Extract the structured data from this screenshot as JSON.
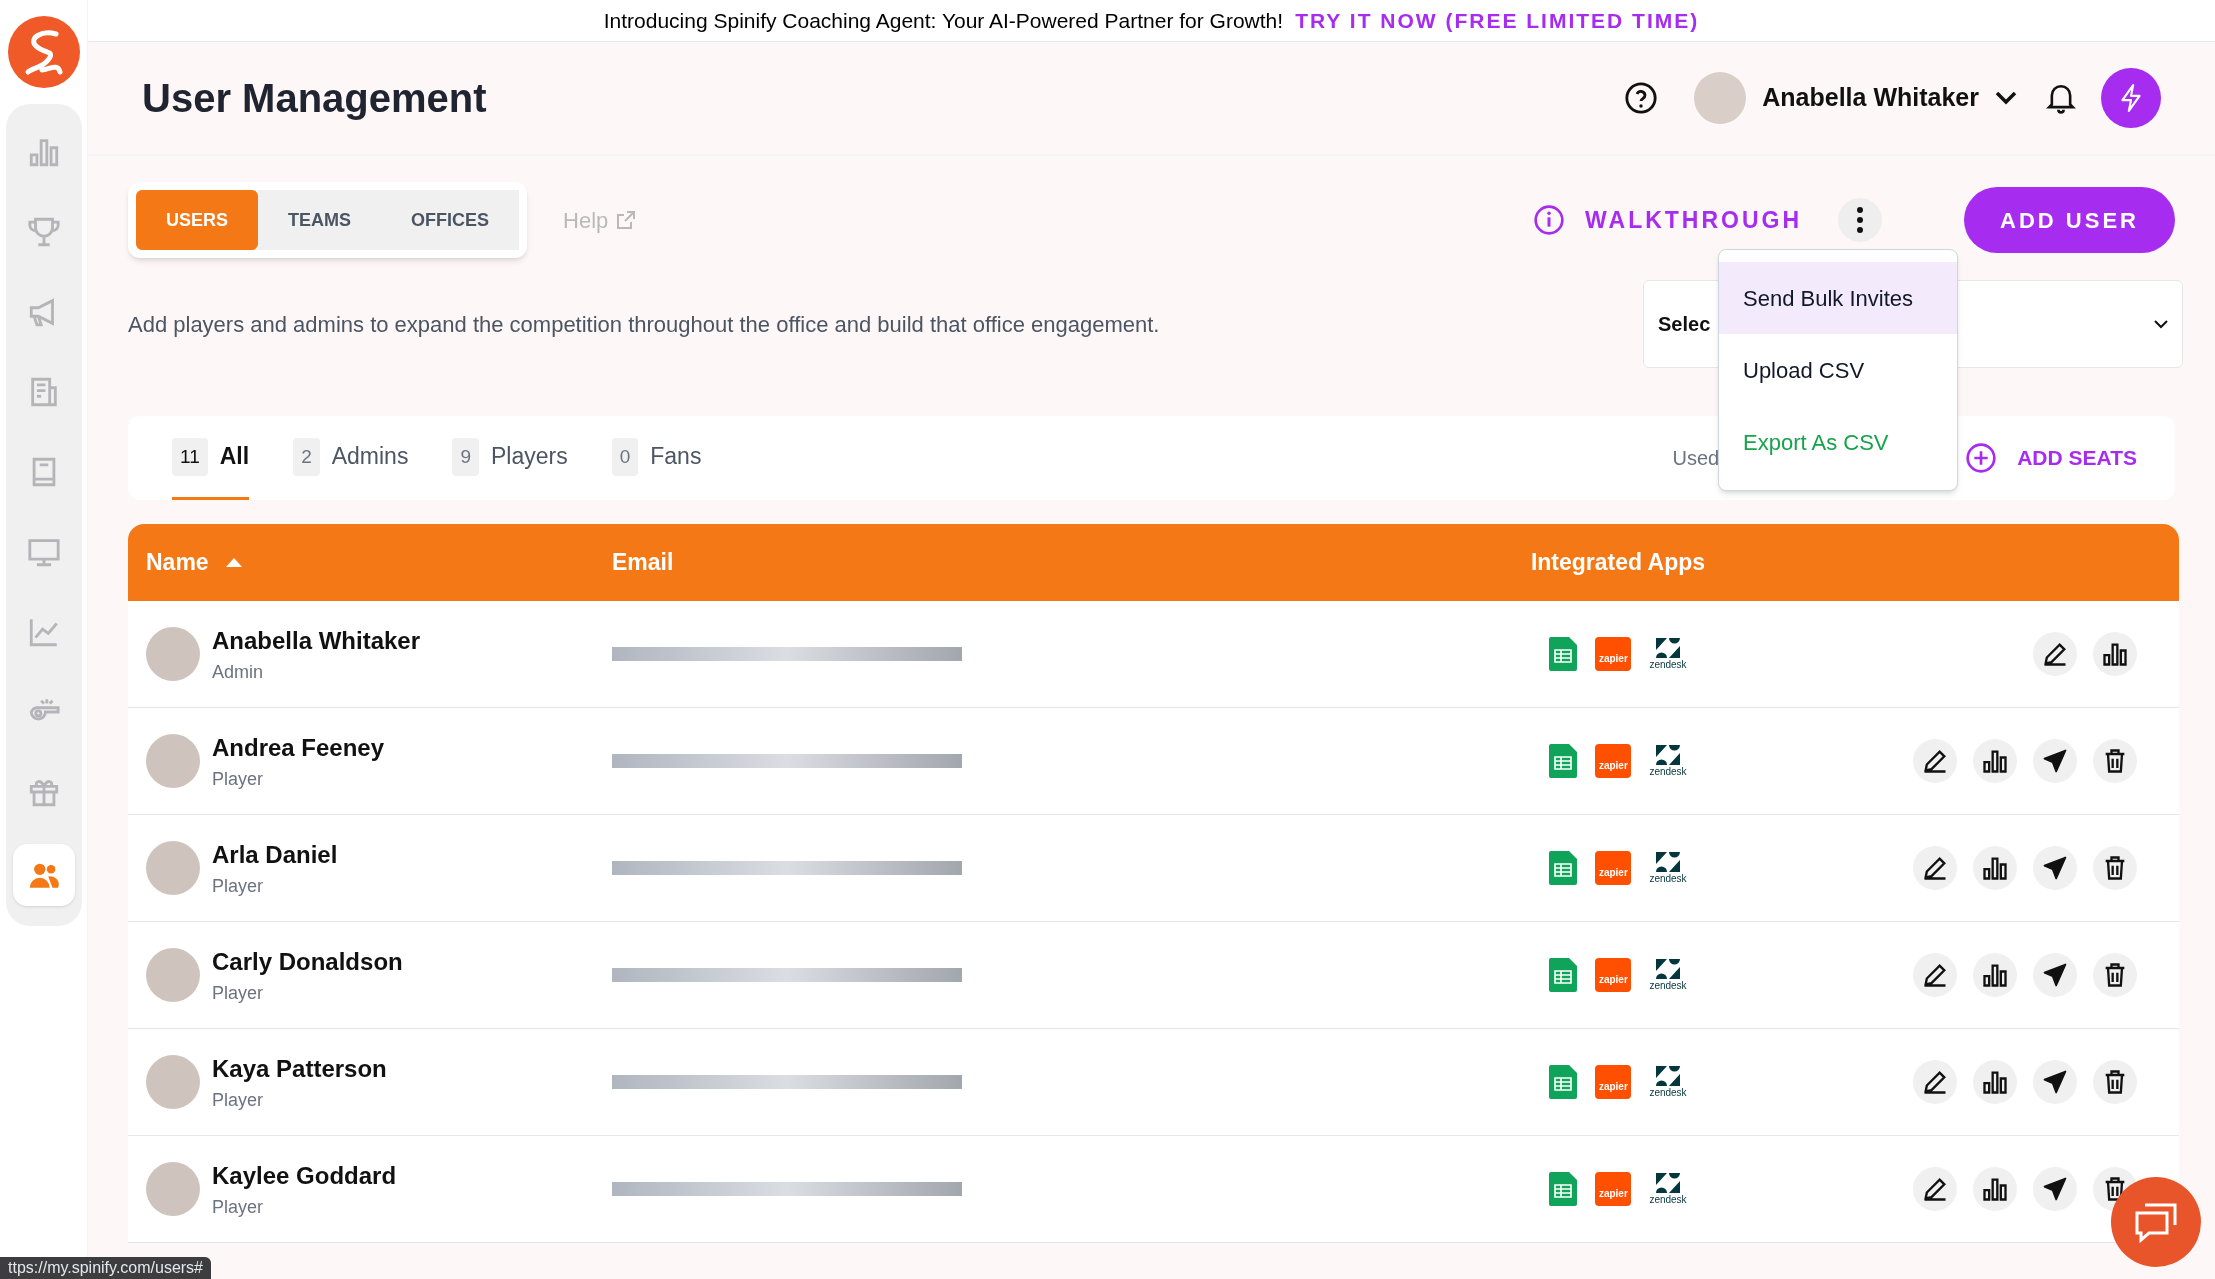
{
  "banner": {
    "text": "Introducing Spinify Coaching Agent: Your AI-Powered Partner for Growth!",
    "link": "TRY IT NOW (FREE LIMITED TIME)"
  },
  "sidebar": {
    "items": [
      {
        "kind": "bars",
        "selected": false
      },
      {
        "kind": "trophy",
        "selected": false
      },
      {
        "kind": "megaphone",
        "selected": false
      },
      {
        "kind": "report",
        "selected": false
      },
      {
        "kind": "book",
        "selected": false
      },
      {
        "kind": "monitor",
        "selected": false
      },
      {
        "kind": "trend",
        "selected": false
      },
      {
        "kind": "whistle",
        "selected": false
      },
      {
        "kind": "gift",
        "selected": false
      },
      {
        "kind": "users",
        "selected": true
      }
    ]
  },
  "header": {
    "title": "User Management",
    "user_name": "Anabella Whitaker"
  },
  "view_tabs": [
    {
      "label": "USERS",
      "selected": true
    },
    {
      "label": "TEAMS",
      "selected": false
    },
    {
      "label": "OFFICES",
      "selected": false
    }
  ],
  "help_link": "Help",
  "walkthrough": "WALKTHROUGH",
  "add_user": "ADD USER",
  "description": "Add players and admins to expand the competition throughout the office and build that office engagement.",
  "select": {
    "value": "Selec"
  },
  "menu": [
    {
      "label": "Send Bulk Invites",
      "selected": true,
      "color": "#111827"
    },
    {
      "label": "Upload CSV",
      "selected": false,
      "color": "#111827"
    },
    {
      "label": "Export As CSV",
      "selected": false,
      "color": "#16a34a"
    }
  ],
  "role_filters": [
    {
      "count": "11",
      "label": "All",
      "selected": true
    },
    {
      "count": "2",
      "label": "Admins",
      "selected": false
    },
    {
      "count": "9",
      "label": "Players",
      "selected": false
    },
    {
      "count": "0",
      "label": "Fans",
      "selected": false
    }
  ],
  "used": "Used",
  "add_seats": "ADD SEATS",
  "table": {
    "columns": [
      {
        "label": "Name",
        "sorted": true
      },
      {
        "label": "Email",
        "sorted": false
      },
      {
        "label": "Integrated Apps",
        "sorted": false
      }
    ],
    "rows": [
      {
        "name": "Anabella Whitaker",
        "role": "Admin",
        "apps": [
          {
            "kind": "sheets"
          },
          {
            "kind": "zapier",
            "label": "zapier"
          },
          {
            "kind": "zendesk",
            "label": "zendesk"
          }
        ],
        "actions": [
          {
            "kind": "edit"
          },
          {
            "kind": "stats"
          }
        ]
      },
      {
        "name": "Andrea Feeney",
        "role": "Player",
        "apps": [
          {
            "kind": "sheets"
          },
          {
            "kind": "zapier",
            "label": "zapier"
          },
          {
            "kind": "zendesk",
            "label": "zendesk"
          }
        ],
        "actions": [
          {
            "kind": "edit"
          },
          {
            "kind": "stats"
          },
          {
            "kind": "send"
          },
          {
            "kind": "delete"
          }
        ]
      },
      {
        "name": "Arla Daniel",
        "role": "Player",
        "apps": [
          {
            "kind": "sheets"
          },
          {
            "kind": "zapier",
            "label": "zapier"
          },
          {
            "kind": "zendesk",
            "label": "zendesk"
          }
        ],
        "actions": [
          {
            "kind": "edit"
          },
          {
            "kind": "stats"
          },
          {
            "kind": "send"
          },
          {
            "kind": "delete"
          }
        ]
      },
      {
        "name": "Carly Donaldson",
        "role": "Player",
        "apps": [
          {
            "kind": "sheets"
          },
          {
            "kind": "zapier",
            "label": "zapier"
          },
          {
            "kind": "zendesk",
            "label": "zendesk"
          }
        ],
        "actions": [
          {
            "kind": "edit"
          },
          {
            "kind": "stats"
          },
          {
            "kind": "send"
          },
          {
            "kind": "delete"
          }
        ]
      },
      {
        "name": "Kaya Patterson",
        "role": "Player",
        "apps": [
          {
            "kind": "sheets"
          },
          {
            "kind": "zapier",
            "label": "zapier"
          },
          {
            "kind": "zendesk",
            "label": "zendesk"
          }
        ],
        "actions": [
          {
            "kind": "edit"
          },
          {
            "kind": "stats"
          },
          {
            "kind": "send"
          },
          {
            "kind": "delete"
          }
        ]
      },
      {
        "name": "Kaylee Goddard",
        "role": "Player",
        "apps": [
          {
            "kind": "sheets"
          },
          {
            "kind": "zapier",
            "label": "zapier"
          },
          {
            "kind": "zendesk",
            "label": "zendesk"
          }
        ],
        "actions": [
          {
            "kind": "edit"
          },
          {
            "kind": "stats"
          },
          {
            "kind": "send"
          },
          {
            "kind": "delete"
          }
        ]
      }
    ]
  },
  "status_url": "ttps://my.spinify.com/users#"
}
